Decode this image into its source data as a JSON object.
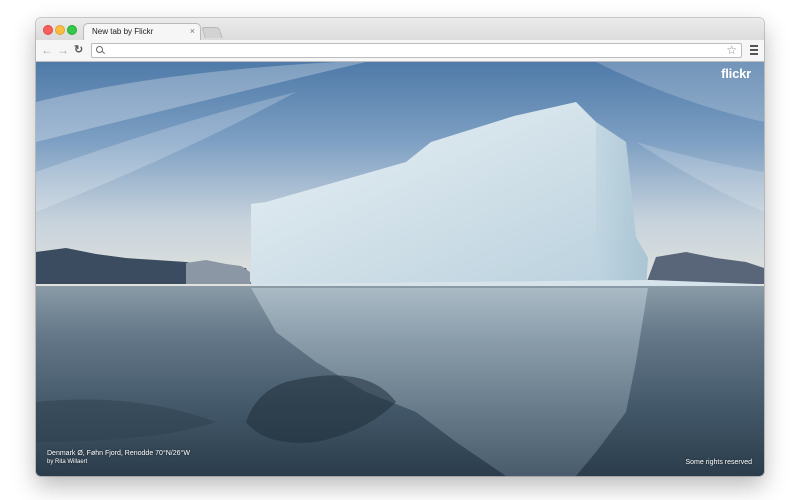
{
  "browser": {
    "tab_title": "New tab by Flickr",
    "tab_close": "×",
    "back_icon": "back-arrow-icon",
    "forward_icon": "forward-arrow-icon",
    "reload_icon": "reload-icon",
    "search_icon": "search-icon",
    "bookmark_icon": "star-icon",
    "menu_icon": "hamburger-menu-icon",
    "address_value": ""
  },
  "page": {
    "logo": "flickr",
    "photo_location": "Denmark Ø, Føhn Fjord, Renodde 70°N/26°W",
    "photo_author": "by Rita Willaert",
    "rights": "Some rights reserved"
  },
  "colors": {
    "sky": "#6f93bc",
    "ice": "#dbe8ef",
    "water": "#3a4f5f"
  }
}
